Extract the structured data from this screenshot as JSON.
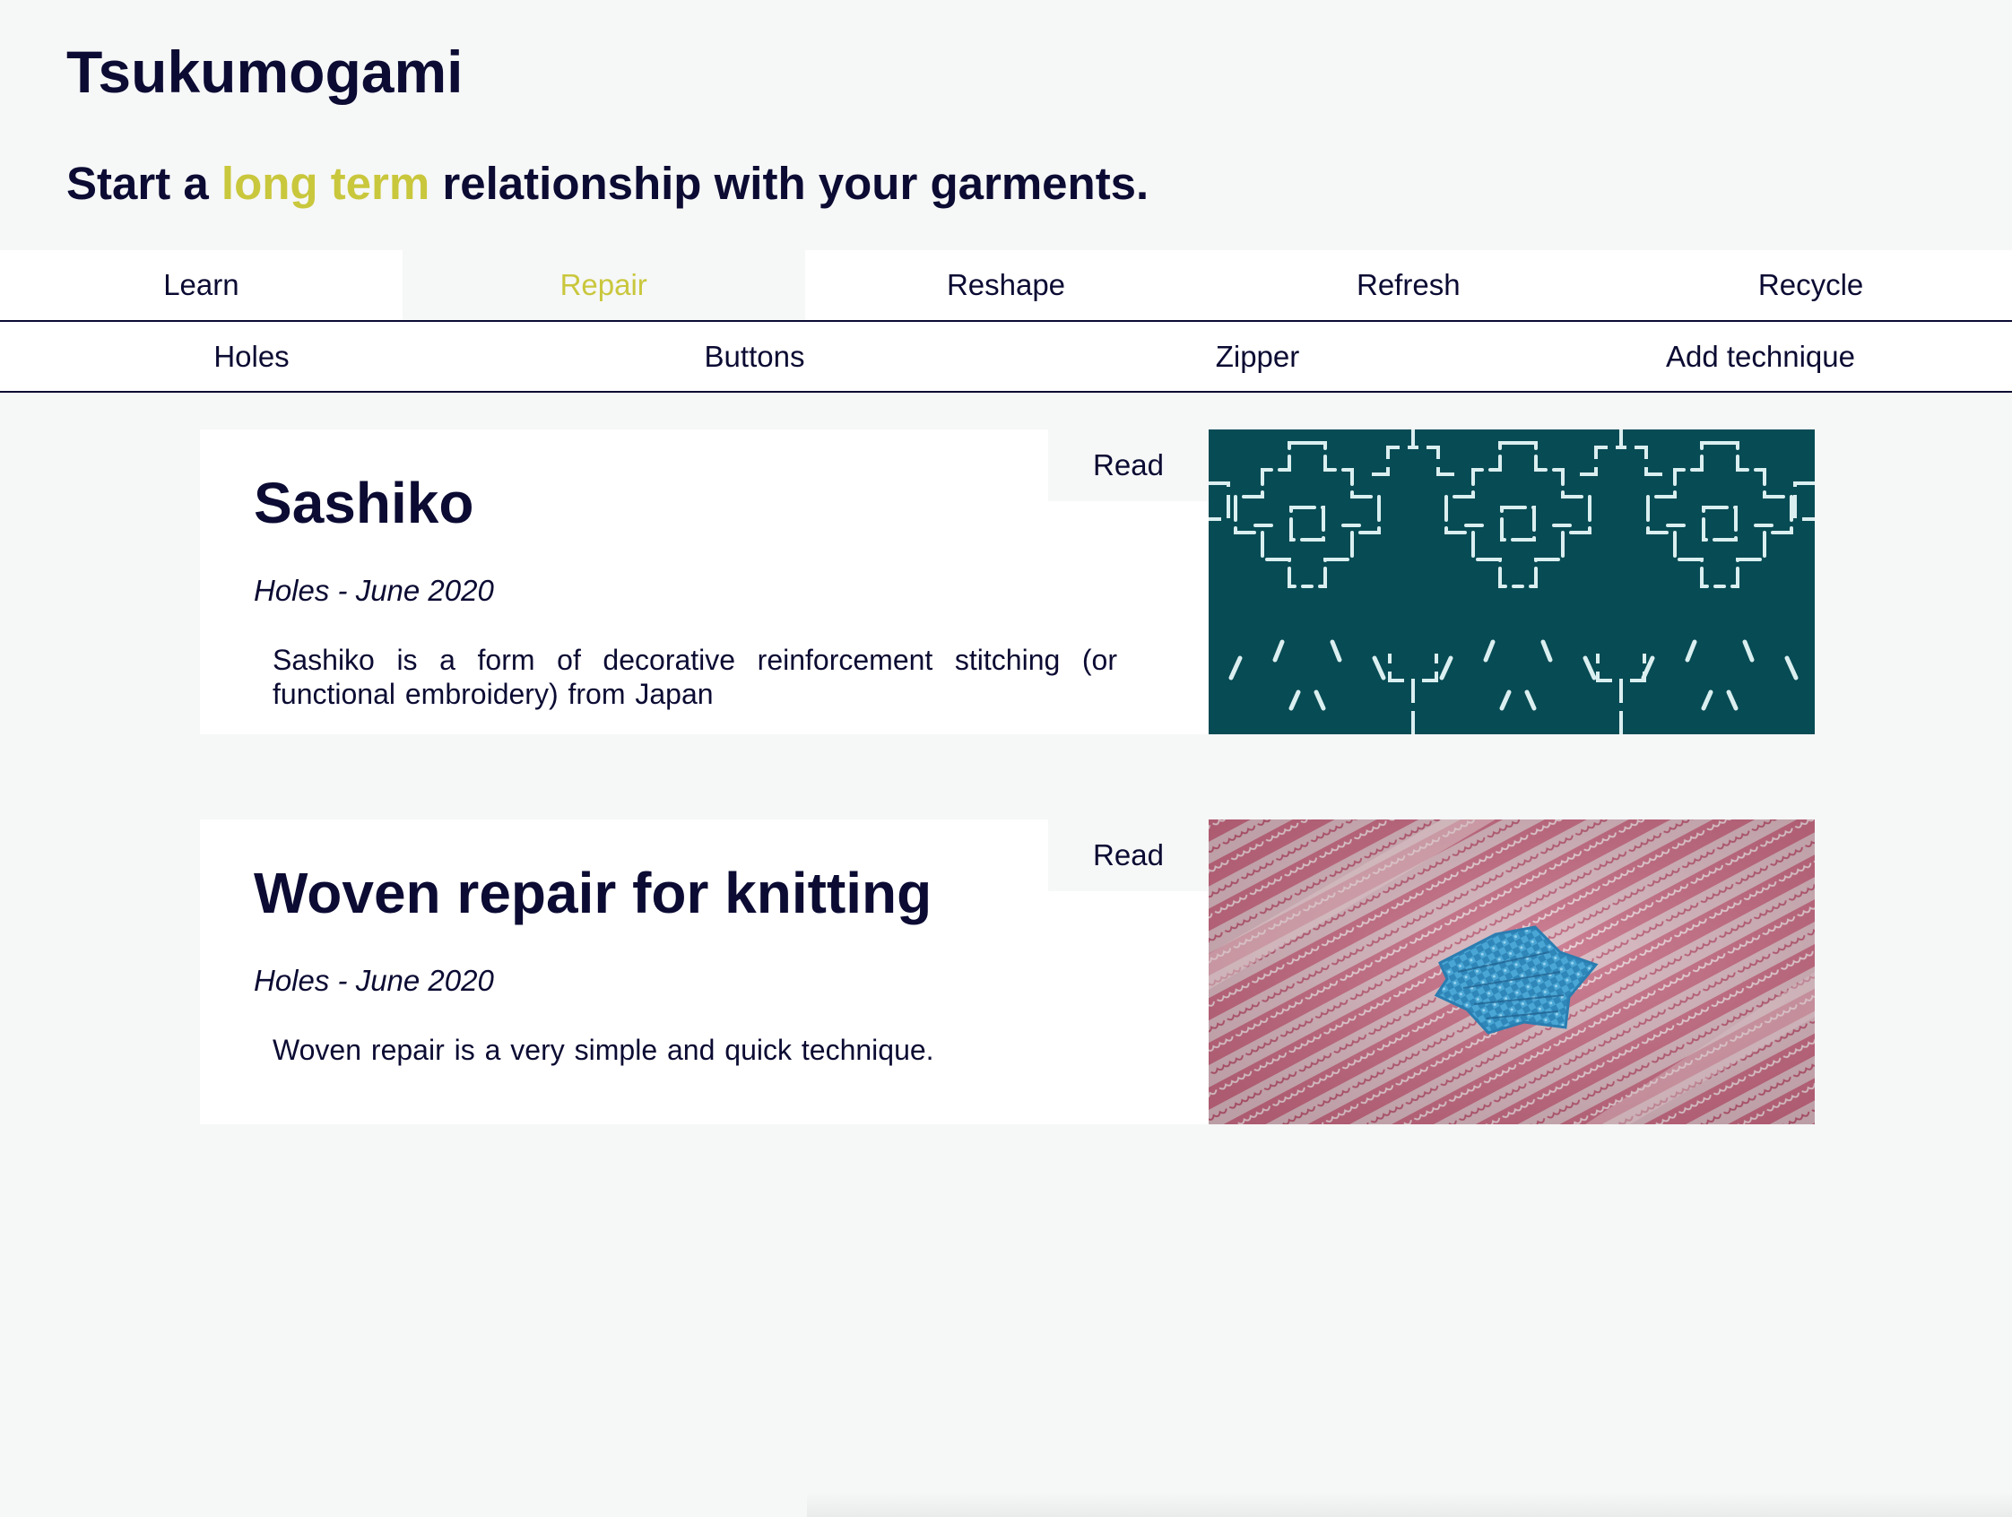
{
  "site": {
    "title": "Tsukumogami",
    "tagline_start": "Start a ",
    "tagline_accent": "long term",
    "tagline_end": " relationship with your garments."
  },
  "colors": {
    "accent": "#c9c73c",
    "text": "#0b0b33",
    "background": "#f6f7f7",
    "sashiko_teal": "#074b54",
    "knit_pink": "#c4677f",
    "patch_blue": "#4aa6d4"
  },
  "primary_nav": {
    "tabs": [
      {
        "label": "Learn",
        "active": false
      },
      {
        "label": "Repair",
        "active": true
      },
      {
        "label": "Reshape",
        "active": false
      },
      {
        "label": "Refresh",
        "active": false
      },
      {
        "label": "Recycle",
        "active": false
      }
    ]
  },
  "secondary_nav": {
    "items": [
      {
        "label": "Holes"
      },
      {
        "label": "Buttons"
      },
      {
        "label": "Zipper"
      },
      {
        "label": "Add technique"
      }
    ]
  },
  "articles": [
    {
      "title": "Sashiko",
      "meta": "Holes - June 2020",
      "description": "Sashiko is a form of decorative reinforcement stitching (or functional embroidery) from Japan",
      "read_label": "Read",
      "image_icon": "sashiko-stitch-pattern-image"
    },
    {
      "title": "Woven repair for knitting",
      "meta": "Holes - June 2020",
      "description": "Woven repair is a very simple and quick technique.",
      "read_label": "Read",
      "image_icon": "woven-knit-patch-image"
    }
  ]
}
